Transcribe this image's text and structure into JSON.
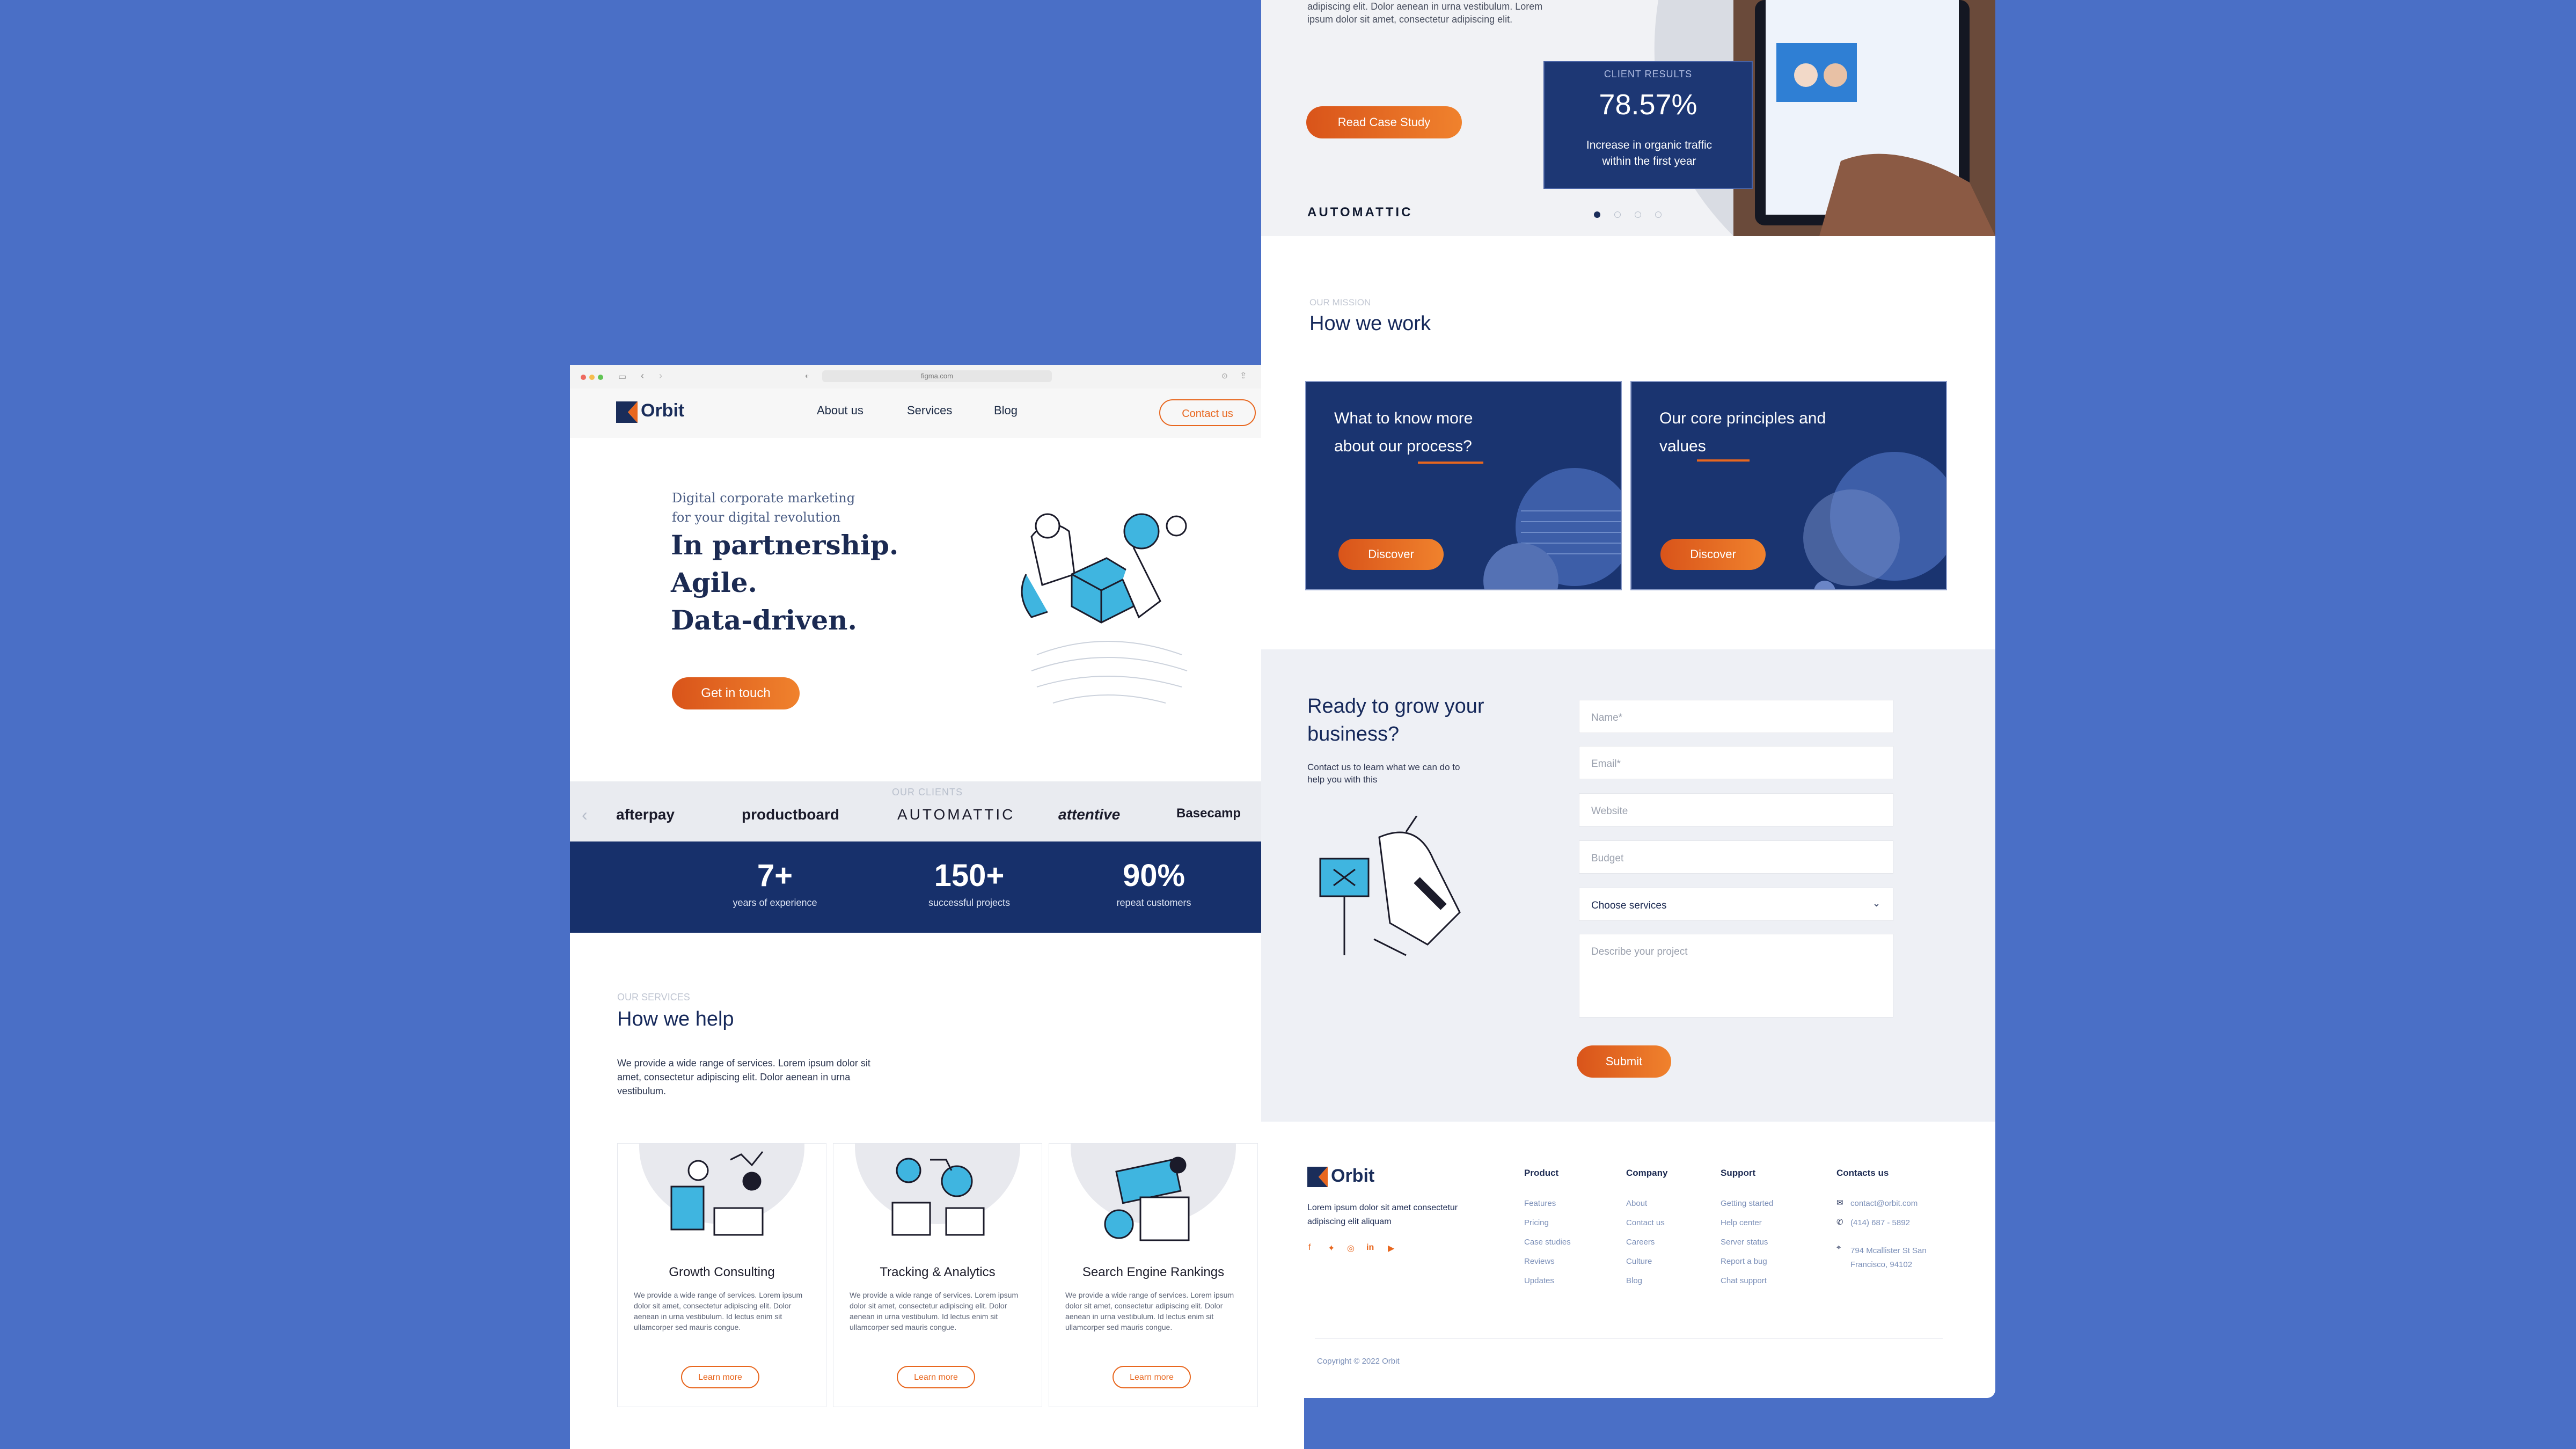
{
  "browser": {
    "url": "figma.com",
    "logo": "Orbit",
    "nav": [
      "About us",
      "Services",
      "Blog"
    ],
    "contact_button": "Contact us",
    "hero": {
      "subtitle": "Digital corporate marketing for your digital revolution",
      "lines": [
        "In partnership.",
        "Agile.",
        "Data-driven."
      ],
      "cta": "Get in touch"
    },
    "clients": {
      "label": "OUR CLIENTS",
      "logos": [
        "afterpay",
        "productboard",
        "AUTOMATTIC",
        "attentive",
        "Basecamp"
      ]
    },
    "stats": [
      {
        "value": "7+",
        "label": "years of experience"
      },
      {
        "value": "150+",
        "label": "successful projects"
      },
      {
        "value": "90%",
        "label": "repeat customers"
      }
    ],
    "services": {
      "kicker": "OUR SERVICES",
      "title": "How we help",
      "description": "We provide a wide range of services. Lorem ipsum dolor sit amet, consectetur adipiscing elit. Dolor aenean in urna vestibulum.",
      "cards": [
        {
          "title": "Growth Consulting",
          "text": "We provide a wide range of services. Lorem ipsum dolor sit amet, consectetur adipiscing elit. Dolor aenean in urna vestibulum. Id lectus enim sit ullamcorper sed mauris congue.",
          "button": "Learn more"
        },
        {
          "title": "Tracking & Analytics",
          "text": "We provide a wide range of services. Lorem ipsum dolor sit amet, consectetur adipiscing elit. Dolor aenean in urna vestibulum. Id lectus enim sit ullamcorper sed mauris congue.",
          "button": "Learn more"
        },
        {
          "title": "Search Engine Rankings",
          "text": "We provide a wide range of services. Lorem ipsum dolor sit amet, consectetur adipiscing elit. Dolor aenean in urna vestibulum. Id lectus enim sit ullamcorper sed mauris congue.",
          "button": "Learn more"
        }
      ]
    }
  },
  "page2": {
    "case_study": {
      "text": "adipiscing elit. Dolor aenean in urna vestibulum. Lorem ipsum dolor sit amet, consectetur adipiscing elit.",
      "button": "Read Case Study",
      "brand": "AUTOMATTIC",
      "result_kicker": "CLIENT RESULTS",
      "result_value": "78.57%",
      "result_desc": "Increase in organic traffic within the first year",
      "slides": 4,
      "active_slide": 1
    },
    "mission": {
      "kicker": "OUR MISSION",
      "title": "How we work",
      "cards": [
        {
          "title": "What to know more about our process?",
          "button": "Discover"
        },
        {
          "title": "Our core principles and values",
          "button": "Discover"
        }
      ]
    },
    "contact": {
      "title": "Ready to grow your business?",
      "description": "Contact us to learn what we can do to help you with this",
      "fields": [
        "Name*",
        "Email*",
        "Website",
        "Budget"
      ],
      "select": "Choose services",
      "textarea": "Describe your project",
      "submit": "Submit"
    },
    "footer": {
      "logo": "Orbit",
      "tagline": "Lorem ipsum dolor sit amet consectetur adipiscing elit aliquam",
      "columns": [
        {
          "title": "Product",
          "links": [
            "Features",
            "Pricing",
            "Case studies",
            "Reviews",
            "Updates"
          ]
        },
        {
          "title": "Company",
          "links": [
            "About",
            "Contact us",
            "Careers",
            "Culture",
            "Blog"
          ]
        },
        {
          "title": "Support",
          "links": [
            "Getting started",
            "Help center",
            "Server status",
            "Report a bug",
            "Chat support"
          ]
        }
      ],
      "contacts_title": "Contacts us",
      "email": "contact@orbit.com",
      "phone": "(414) 687 - 5892",
      "address": "794 Mcallister St San Francisco, 94102",
      "copyright": "Copyright © 2022 Orbit"
    }
  },
  "colors": {
    "background": "#4a6fc6",
    "brand": "#1a2d5a",
    "accent": "#e8671f",
    "stats_bg": "#17306b"
  }
}
